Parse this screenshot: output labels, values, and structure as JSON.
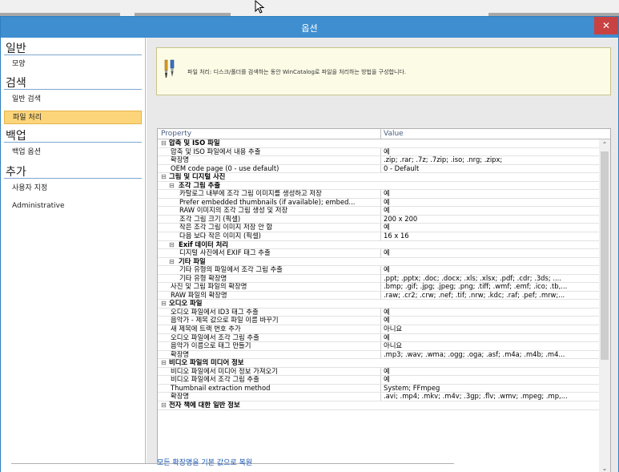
{
  "window": {
    "title": "옵션",
    "close_label": "✕"
  },
  "sidebar": {
    "sections": [
      {
        "heading": "일반",
        "items": [
          "모양"
        ]
      },
      {
        "heading": "검색",
        "items": [
          "일반 검색",
          "파일 처리"
        ]
      },
      {
        "heading": "백업",
        "items": [
          "백업 옵션"
        ]
      },
      {
        "heading": "추가",
        "items": [
          "사용자 지정",
          "Administrative"
        ]
      }
    ],
    "selected": "파일 처리"
  },
  "info": {
    "message": "파일 처리: 디스크/폴더를 검색하는 동안 WinCatalog로 파일을 처리하는 방법을 구성합니다."
  },
  "grid": {
    "headers": {
      "property": "Property",
      "value": "Value"
    },
    "rows": [
      {
        "level": 0,
        "type": "cat",
        "name": "압축 및 ISO 파일",
        "value": ""
      },
      {
        "level": 1,
        "type": "prop",
        "name": "압축 및 ISO 파일에서 내용 추출",
        "value": "예"
      },
      {
        "level": 1,
        "type": "prop",
        "name": "확장명",
        "value": ".zip; .rar; .7z; .7zip; .iso; .nrg; .zipx;"
      },
      {
        "level": 1,
        "type": "prop",
        "name": "OEM code page (0 - use default)",
        "value": "0 - Default"
      },
      {
        "level": 0,
        "type": "cat",
        "name": "그림 및 디지털 사진",
        "value": ""
      },
      {
        "level": 1,
        "type": "sub",
        "name": "조각 그림 추출",
        "value": ""
      },
      {
        "level": 2,
        "type": "prop",
        "name": "카탈로그 내부에 조각 그림 이미지를 생성하고 저장",
        "value": "예"
      },
      {
        "level": 2,
        "type": "prop",
        "name": "Prefer embedded thumbnails (if available); embed...",
        "value": "예"
      },
      {
        "level": 2,
        "type": "prop",
        "name": "RAW 이미지의 조각 그림 생성 및 저장",
        "value": "예"
      },
      {
        "level": 2,
        "type": "prop",
        "name": "조각 그림 크기 (픽셀)",
        "value": "200 x 200"
      },
      {
        "level": 2,
        "type": "prop",
        "name": "작은 조각 그림 이미지 저장 안 함",
        "value": "예"
      },
      {
        "level": 2,
        "type": "prop",
        "name": "다음 보다 작은 이미지 (픽셀)",
        "value": "16 x 16"
      },
      {
        "level": 1,
        "type": "sub",
        "name": "Exif 데이터 처리",
        "value": ""
      },
      {
        "level": 2,
        "type": "prop",
        "name": "디지털 사진에서 EXIF 태그 추출",
        "value": "예"
      },
      {
        "level": 1,
        "type": "sub",
        "name": "기타 파일",
        "value": ""
      },
      {
        "level": 2,
        "type": "prop",
        "name": "기타 유형의 파일에서 조각 그림 추출",
        "value": "예"
      },
      {
        "level": 2,
        "type": "prop",
        "name": "기타 유형 확장명",
        "value": ".ppt; .pptx; .doc; .docx; .xls; .xlsx; .pdf; .cdr; .3ds; ...."
      },
      {
        "level": 1,
        "type": "prop",
        "name": "사진 및 그림 파일의 확장명",
        "value": ".bmp; .gif; .jpg; .jpeg; .png; .tiff; .wmf; .emf; .ico; .tb,..."
      },
      {
        "level": 1,
        "type": "prop",
        "name": "RAW 파일의 확장명",
        "value": ".raw; .cr2; .crw; .nef; .tif; .nrw; .kdc; .raf; .pef; .mrw;..."
      },
      {
        "level": 0,
        "type": "cat",
        "name": "오디오 파일",
        "value": ""
      },
      {
        "level": 1,
        "type": "prop",
        "name": "오디오 파일에서 ID3 태그 추출",
        "value": "예"
      },
      {
        "level": 1,
        "type": "prop",
        "name": "음악가 - 제목 값으로 파일 이름 바꾸기",
        "value": "예"
      },
      {
        "level": 1,
        "type": "prop",
        "name": "새 제목에 트랙 번호 추가",
        "value": "아니요"
      },
      {
        "level": 1,
        "type": "prop",
        "name": "오디오 파일에서 조각 그림 추출",
        "value": "예"
      },
      {
        "level": 1,
        "type": "prop",
        "name": "음악가 이름으로 태그 만들기",
        "value": "아니요"
      },
      {
        "level": 1,
        "type": "prop",
        "name": "확장명",
        "value": ".mp3; .wav; .wma; .ogg; .oga; .asf; .m4a; .m4b; .m4..."
      },
      {
        "level": 0,
        "type": "cat",
        "name": "비디오 파일의 미디어 정보",
        "value": ""
      },
      {
        "level": 1,
        "type": "prop",
        "name": "비디오 파일에서 미디어 정보 가져오기",
        "value": "예"
      },
      {
        "level": 1,
        "type": "prop",
        "name": "비디오 파일에서 조각 그림 추출",
        "value": "예"
      },
      {
        "level": 1,
        "type": "prop",
        "name": "Thumbnail extraction method",
        "value": "System; FFmpeg"
      },
      {
        "level": 1,
        "type": "prop",
        "name": "확장명",
        "value": ".avi; .mp4; .mkv; .m4v; .3gp; .flv; .wmv; .mpeg; .mp,..."
      },
      {
        "level": 0,
        "type": "cat",
        "name": "전자 책에 대한 일반 정보",
        "value": ""
      }
    ]
  },
  "footer": {
    "reset_link": "모든 확장명을 기본 값으로 복원"
  },
  "colors": {
    "titlebar": "#3e8ed0",
    "close": "#c94242",
    "selected": "#fcd57a",
    "info_bg": "#fcfce6"
  }
}
